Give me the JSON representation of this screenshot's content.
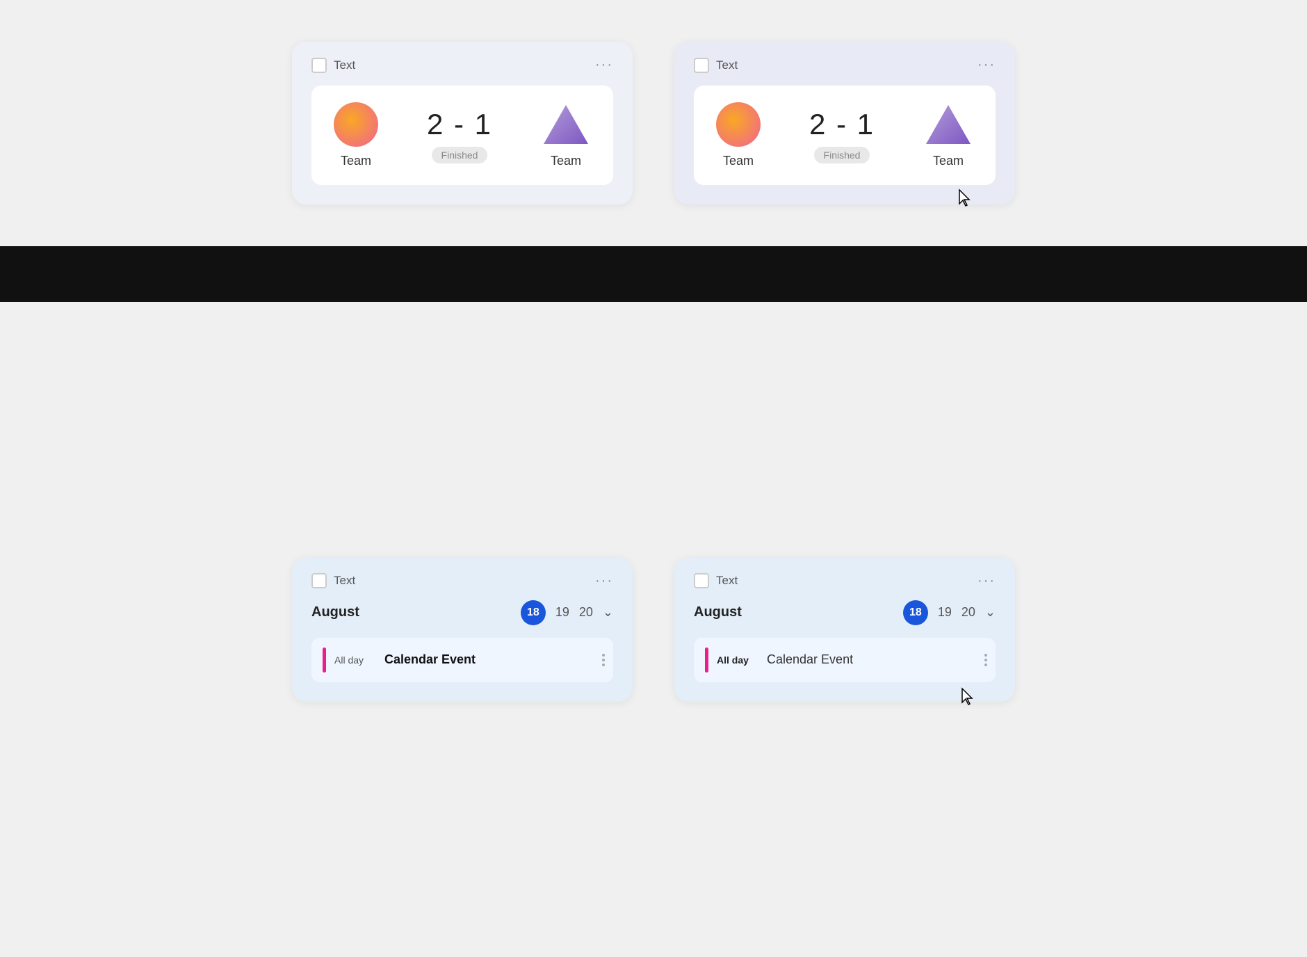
{
  "cards": {
    "score_card_1": {
      "title": "Text",
      "menu": "···",
      "team1_label": "Team",
      "score": "2 - 1",
      "status": "Finished",
      "team2_label": "Team"
    },
    "score_card_2": {
      "title": "Text",
      "menu": "···",
      "team1_label": "Team",
      "score": "2 - 1",
      "status": "Finished",
      "team2_label": "Team",
      "hovered": true
    },
    "cal_card_1": {
      "title": "Text",
      "menu": "···",
      "month": "August",
      "day_active": "18",
      "day2": "19",
      "day3": "20",
      "chevron": "⌄",
      "allday": "All day",
      "event_name": "Calendar Event"
    },
    "cal_card_2": {
      "title": "Text",
      "menu": "···",
      "month": "August",
      "day_active": "18",
      "day2": "19",
      "day3": "20",
      "chevron": "⌄",
      "allday": "All day",
      "event_name": "Calendar Event",
      "hovered": true
    }
  },
  "icons": {
    "menu_dots": "···",
    "chevron_down": "⌄"
  }
}
